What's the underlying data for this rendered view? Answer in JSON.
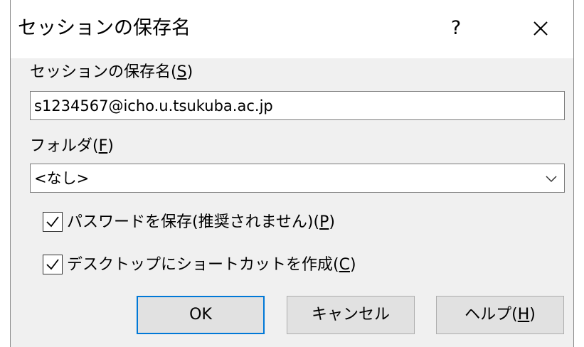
{
  "dialog": {
    "title": "セッションの保存名",
    "help_button": "?",
    "session_name": {
      "label": "セッションの保存名(",
      "mnemonic": "S",
      "label_suffix": ")",
      "value": "s1234567@icho.u.tsukuba.ac.jp"
    },
    "folder": {
      "label": "フォルダ(",
      "mnemonic": "F",
      "label_suffix": ")",
      "selected": "<なし>"
    },
    "save_password": {
      "checked": true,
      "label": "パスワードを保存(推奨されません)(",
      "mnemonic": "P",
      "label_suffix": ")"
    },
    "desktop_shortcut": {
      "checked": true,
      "label": "デスクトップにショートカットを作成(",
      "mnemonic": "C",
      "label_suffix": ")"
    },
    "buttons": {
      "ok": "OK",
      "cancel": "キャンセル",
      "help": "ヘルプ(",
      "help_mnemonic": "H",
      "help_suffix": ")"
    }
  }
}
